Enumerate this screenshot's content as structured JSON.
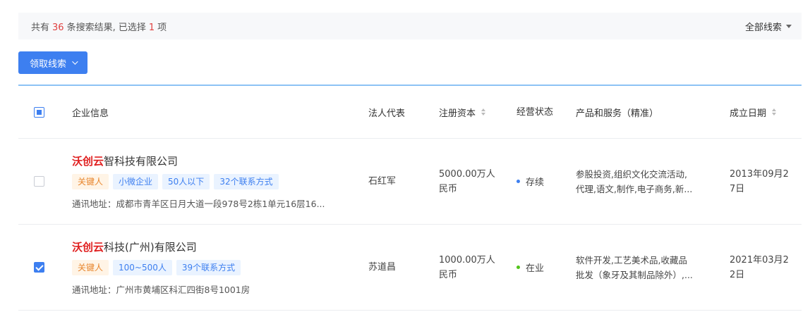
{
  "summary": {
    "prefix": "共有",
    "total": "36",
    "middle": "条搜索结果, 已选择",
    "selected": "1",
    "suffix": "项",
    "filter_label": "全部线索"
  },
  "toolbar": {
    "claim_label": "领取线索"
  },
  "table": {
    "headers": {
      "info": "企业信息",
      "legal": "法人代表",
      "capital": "注册资本",
      "status": "经营状态",
      "products": "产品和服务（精准）",
      "date": "成立日期"
    },
    "rows": [
      {
        "name_highlight": "沃创云",
        "name_rest": "智科技有限公司",
        "tags": [
          "关键人",
          "小微企业",
          "50人以下",
          "32个联系方式"
        ],
        "address": "通讯地址：成都市青羊区日月大道一段978号2栋1单元16层16...",
        "legal": "石红军",
        "capital_1": "5000.00万人",
        "capital_2": "民币",
        "status": "存续",
        "status_color": "#3d7ff0",
        "products_1": "参股投资,组织文化交流活动,",
        "products_2": "代理,语文,制作,电子商务,新...",
        "date_1": "2013年09月2",
        "date_2": "7日",
        "checked": false
      },
      {
        "name_highlight": "沃创云",
        "name_rest": "科技(广州)有限公司",
        "tags": [
          "关键人",
          "100~500人",
          "39个联系方式"
        ],
        "address": "通讯地址：广州市黄埔区科汇四街8号1001房",
        "legal": "苏道昌",
        "capital_1": "1000.00万人",
        "capital_2": "民币",
        "status": "在业",
        "status_color": "#52c41a",
        "products_1": "软件开发,工艺美术品,收藏品",
        "products_2": "批发（象牙及其制品除外）,...",
        "date_1": "2021年03月2",
        "date_2": "2日",
        "checked": true
      }
    ]
  }
}
